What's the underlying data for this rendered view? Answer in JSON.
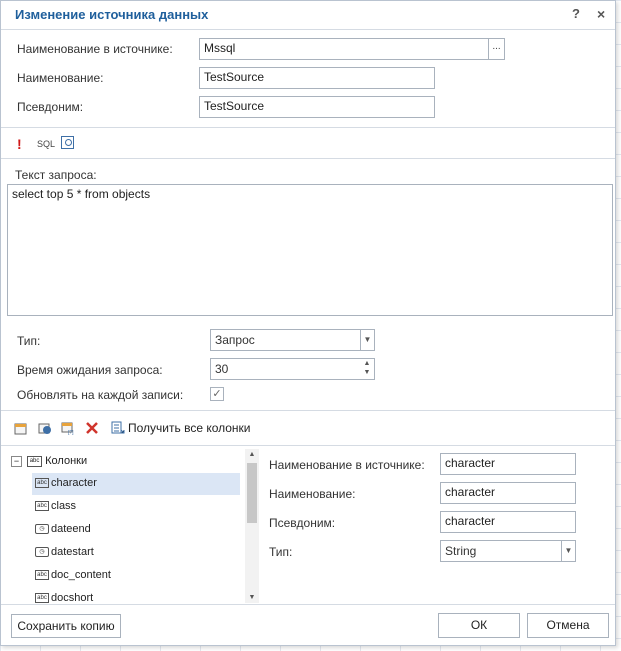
{
  "dialog": {
    "title": "Изменение источника данных",
    "help": "?",
    "close": "×"
  },
  "source": {
    "name_in_source_label": "Наименование в источнике:",
    "name_in_source_value": "Mssql",
    "ellipsis": "...",
    "name_label": "Наименование:",
    "name_value": "TestSource",
    "alias_label": "Псевдоним:",
    "alias_value": "TestSource"
  },
  "toolbar": {
    "execute_icon": "!",
    "sql_label": "SQL",
    "preview_icon": "preview-icon"
  },
  "query": {
    "label": "Текст запроса:",
    "text": "select top 5 * from objects"
  },
  "settings": {
    "type_label": "Тип:",
    "type_value": "Запрос",
    "timeout_label": "Время ожидания запроса:",
    "timeout_value": "30",
    "refresh_label": "Обновлять на каждой записи:",
    "refresh_checked": "✓"
  },
  "columns_toolbar": {
    "get_all_label": "Получить все колонки"
  },
  "tree": {
    "root_label": "Колонки",
    "expand": "−",
    "items": [
      {
        "label": "character",
        "icon": "abc"
      },
      {
        "label": "class",
        "icon": "abc"
      },
      {
        "label": "dateend",
        "icon": "clock"
      },
      {
        "label": "datestart",
        "icon": "clock"
      },
      {
        "label": "doc_content",
        "icon": "abc"
      },
      {
        "label": "docshort",
        "icon": "abc"
      }
    ]
  },
  "column_props": {
    "name_in_source_label": "Наименование в источнике:",
    "name_in_source_value": "character",
    "name_label": "Наименование:",
    "name_value": "character",
    "alias_label": "Псевдоним:",
    "alias_value": "character",
    "type_label": "Тип:",
    "type_value": "String"
  },
  "footer": {
    "save_copy": "Сохранить копию",
    "ok": "ОК",
    "cancel": "Отмена"
  }
}
